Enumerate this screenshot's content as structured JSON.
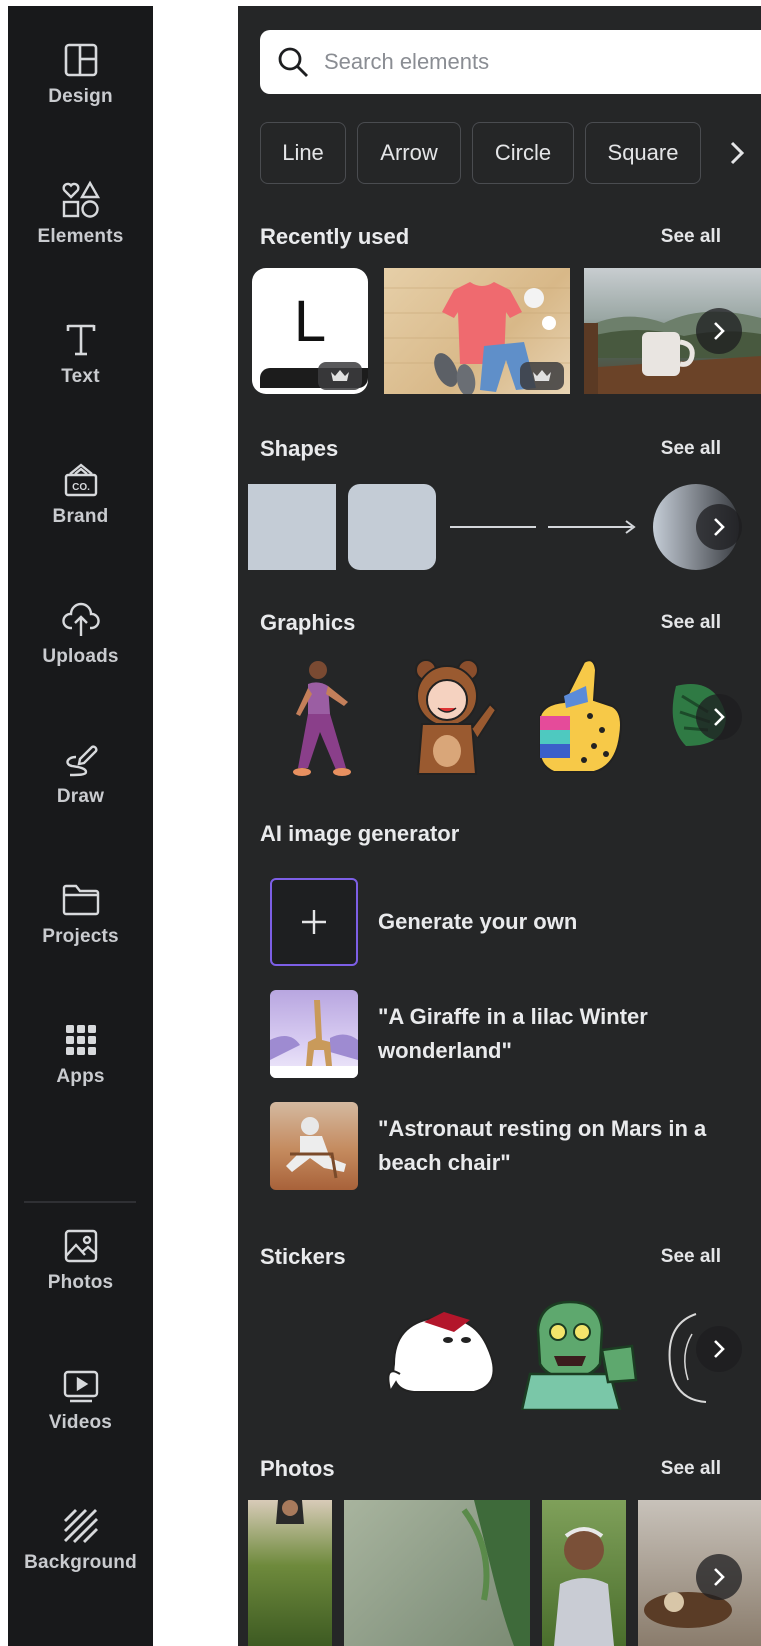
{
  "sidebar": {
    "items": [
      {
        "label": "Design",
        "icon": "layout-icon"
      },
      {
        "label": "Elements",
        "icon": "shapes-icon"
      },
      {
        "label": "Text",
        "icon": "text-t-icon"
      },
      {
        "label": "Brand",
        "icon": "brand-bag-icon"
      },
      {
        "label": "Uploads",
        "icon": "cloud-upload-icon"
      },
      {
        "label": "Draw",
        "icon": "pen-squiggle-icon"
      },
      {
        "label": "Projects",
        "icon": "folder-icon"
      },
      {
        "label": "Apps",
        "icon": "grid-dots-icon"
      },
      {
        "label": "Photos",
        "icon": "image-icon"
      },
      {
        "label": "Videos",
        "icon": "video-play-icon"
      },
      {
        "label": "Background",
        "icon": "hatch-icon"
      }
    ]
  },
  "search": {
    "placeholder": "Search elements"
  },
  "chips": [
    "Line",
    "Arrow",
    "Circle",
    "Square"
  ],
  "sections": {
    "recent": {
      "title": "Recently used",
      "see_all": "See all",
      "letter_tile": "L"
    },
    "shapes": {
      "title": "Shapes",
      "see_all": "See all"
    },
    "graphics": {
      "title": "Graphics",
      "see_all": "See all"
    },
    "ai": {
      "title": "AI image generator",
      "items": [
        {
          "text": "Generate your own"
        },
        {
          "text": "\"A Giraffe in a lilac Winter wonderland\""
        },
        {
          "text": "\"Astronaut resting on Mars in a beach chair\""
        }
      ]
    },
    "stickers": {
      "title": "Stickers",
      "see_all": "See all"
    },
    "photos": {
      "title": "Photos",
      "see_all": "See all"
    }
  },
  "colors": {
    "sidebar_bg": "#18191b",
    "panel_bg": "#252627",
    "shape_fill": "#c4ccd6",
    "ai_accent": "#7d5fe6"
  }
}
